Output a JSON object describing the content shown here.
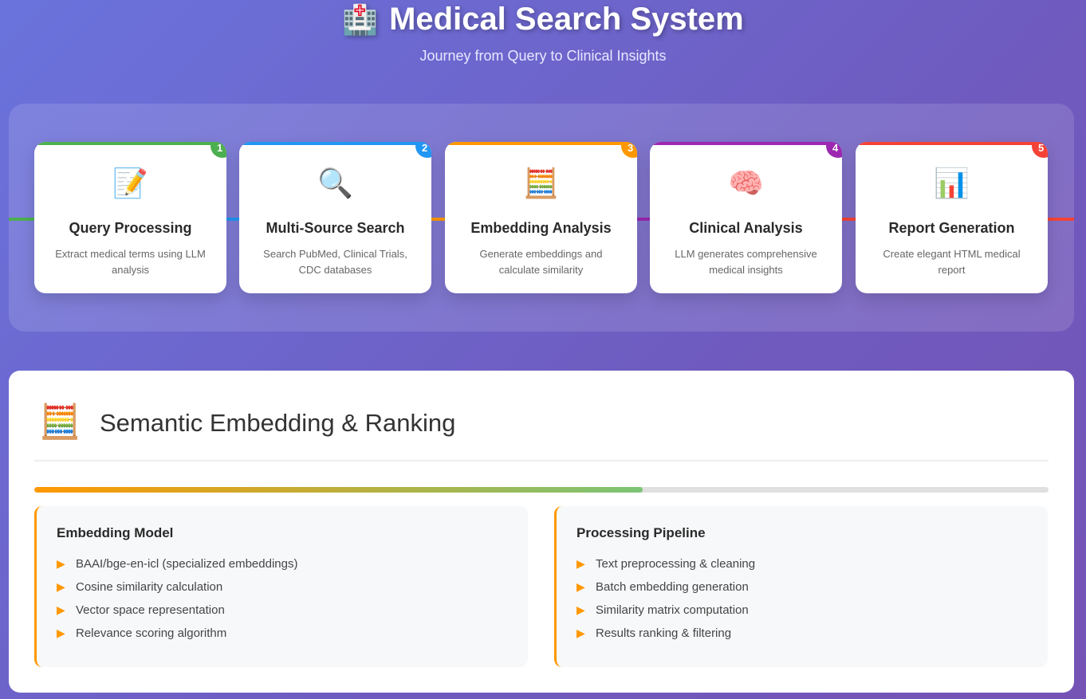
{
  "header": {
    "icon": "🏥",
    "title": "Medical Search System",
    "subtitle": "Journey from Query to Clinical Insights"
  },
  "steps": [
    {
      "number": "1",
      "icon": "📝",
      "title": "Query Processing",
      "desc": "Extract medical terms using LLM analysis",
      "color": "#4caf50"
    },
    {
      "number": "2",
      "icon": "🔍",
      "title": "Multi-Source Search",
      "desc": "Search PubMed, Clinical Trials, CDC databases",
      "color": "#2196f3"
    },
    {
      "number": "3",
      "icon": "🧮",
      "title": "Embedding Analysis",
      "desc": "Generate embeddings and calculate similarity",
      "color": "#ff9800"
    },
    {
      "number": "4",
      "icon": "🧠",
      "title": "Clinical Analysis",
      "desc": "LLM generates comprehensive medical insights",
      "color": "#9c27b0"
    },
    {
      "number": "5",
      "icon": "📊",
      "title": "Report Generation",
      "desc": "Create elegant HTML medical report",
      "color": "#f44336"
    }
  ],
  "section": {
    "icon": "🧮",
    "title": "Semantic Embedding & Ranking",
    "progress_percent": 60,
    "boxes": [
      {
        "title": "Embedding Model",
        "items": [
          "BAAI/bge-en-icl (specialized embeddings)",
          "Cosine similarity calculation",
          "Vector space representation",
          "Relevance scoring algorithm"
        ]
      },
      {
        "title": "Processing Pipeline",
        "items": [
          "Text preprocessing & cleaning",
          "Batch embedding generation",
          "Similarity matrix computation",
          "Results ranking & filtering"
        ]
      }
    ]
  }
}
